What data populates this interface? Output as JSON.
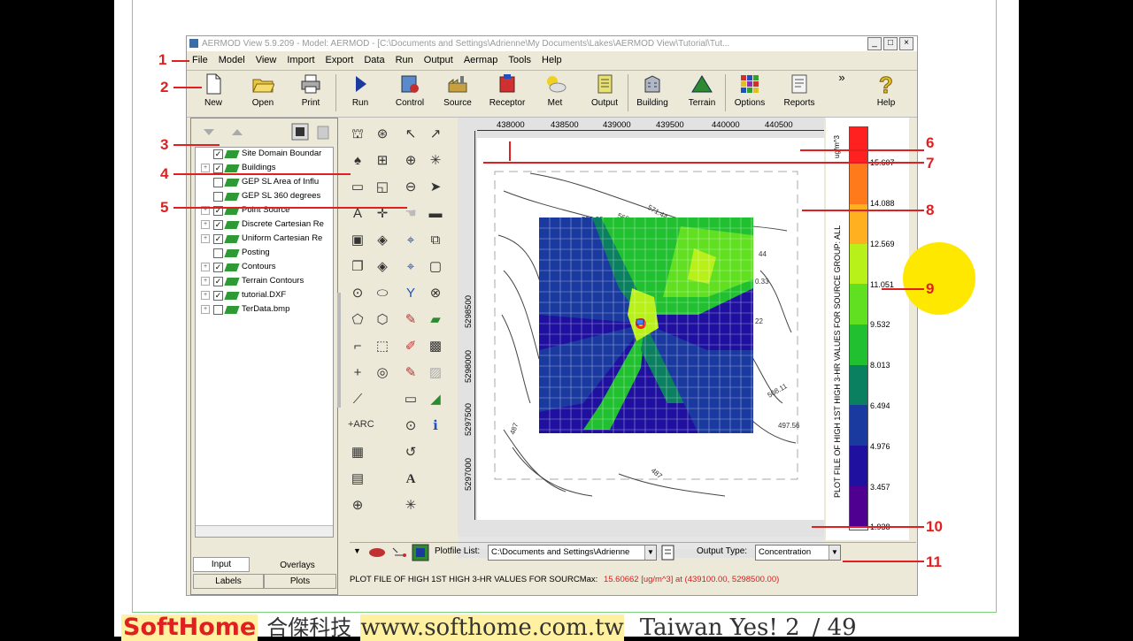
{
  "window": {
    "title": "AERMOD View 5.9.209 - Model: AERMOD - [C:\\Documents and Settings\\Adrienne\\My Documents\\Lakes\\AERMOD View\\Tutorial\\Tut...",
    "min": "_",
    "max": "□",
    "close": "×"
  },
  "menu": [
    "File",
    "Model",
    "View",
    "Import",
    "Export",
    "Data",
    "Run",
    "Output",
    "Aermap",
    "Tools",
    "Help"
  ],
  "toolbar": {
    "new": "New",
    "open": "Open",
    "print": "Print",
    "run": "Run",
    "control": "Control",
    "source": "Source",
    "receptor": "Receptor",
    "met": "Met",
    "output": "Output",
    "building": "Building",
    "terrain": "Terrain",
    "options": "Options",
    "reports": "Reports",
    "help": "Help",
    "more": "»"
  },
  "layers": [
    {
      "label": "Site Domain Boundar",
      "checked": "✓",
      "expand": ""
    },
    {
      "label": "Buildings",
      "checked": "✓",
      "expand": "+"
    },
    {
      "label": "GEP SL Area of Influ",
      "checked": "",
      "expand": ""
    },
    {
      "label": "GEP SL 360 degrees",
      "checked": "",
      "expand": ""
    },
    {
      "label": "Point Source",
      "checked": "✓",
      "expand": "+"
    },
    {
      "label": "Discrete Cartesian Re",
      "checked": "✓",
      "expand": "+"
    },
    {
      "label": "Uniform Cartesian Re",
      "checked": "✓",
      "expand": "+"
    },
    {
      "label": "Posting",
      "checked": "",
      "expand": ""
    },
    {
      "label": "Contours",
      "checked": "✓",
      "expand": "+"
    },
    {
      "label": "Terrain Contours",
      "checked": "✓",
      "expand": "+"
    },
    {
      "label": "tutorial.DXF",
      "checked": "✓",
      "expand": "+"
    },
    {
      "label": "TerData.bmp",
      "checked": "",
      "expand": "+"
    }
  ],
  "left_tabs": {
    "input": "Input",
    "overlays": "Overlays",
    "labels": "Labels",
    "plots": "Plots"
  },
  "plot": {
    "x_ticks": [
      "438000",
      "438500",
      "439000",
      "439500",
      "440000",
      "440500"
    ],
    "y_ticks": [
      "5298500",
      "5298000",
      "5297500",
      "5297000"
    ],
    "contour_labels": [
      "550.33",
      "560.89",
      "571.44",
      "44",
      "0.33",
      "22",
      "508.11",
      "497.56",
      "487",
      "487"
    ]
  },
  "legend": {
    "unit": "ug/m^3",
    "title": "PLOT FILE OF HIGH 1ST HIGH 3-HR VALUES FOR SOURCE GROUP: ALL",
    "values": [
      "15.607",
      "14.088",
      "12.569",
      "11.051",
      "9.532",
      "8.013",
      "6.494",
      "4.976",
      "3.457",
      "1.938"
    ],
    "colors": [
      "#ff2020",
      "#ff7a1a",
      "#ffb020",
      "#ffe01a",
      "#b8f01a",
      "#60e020",
      "#20c030",
      "#0a8060",
      "#1a3aa0",
      "#2010a0",
      "#500090"
    ]
  },
  "bottom": {
    "menu_arrow": "▼",
    "plotfile_label": "Plotfile List:",
    "plotfile_value": "C:\\Documents and Settings\\Adrienne",
    "output_type_label": "Output Type:",
    "output_type_value": "Concentration"
  },
  "status": {
    "text": "PLOT FILE OF  HIGH 1ST  HIGH  3-HR VALUES FOR SOURCMax:",
    "max": "15.60662 [ug/m^3]  at  (439100.00, 5298500.00)"
  },
  "annotations": [
    "1",
    "2",
    "3",
    "4",
    "5",
    "6",
    "7",
    "8",
    "9",
    "10",
    "11"
  ],
  "footer": {
    "logo": "SoftHome",
    "chinese": "合傑科技",
    "url": "www.softhome.com.tw",
    "tagline": "Taiwan Yes! 2",
    "page": "/ 49"
  }
}
